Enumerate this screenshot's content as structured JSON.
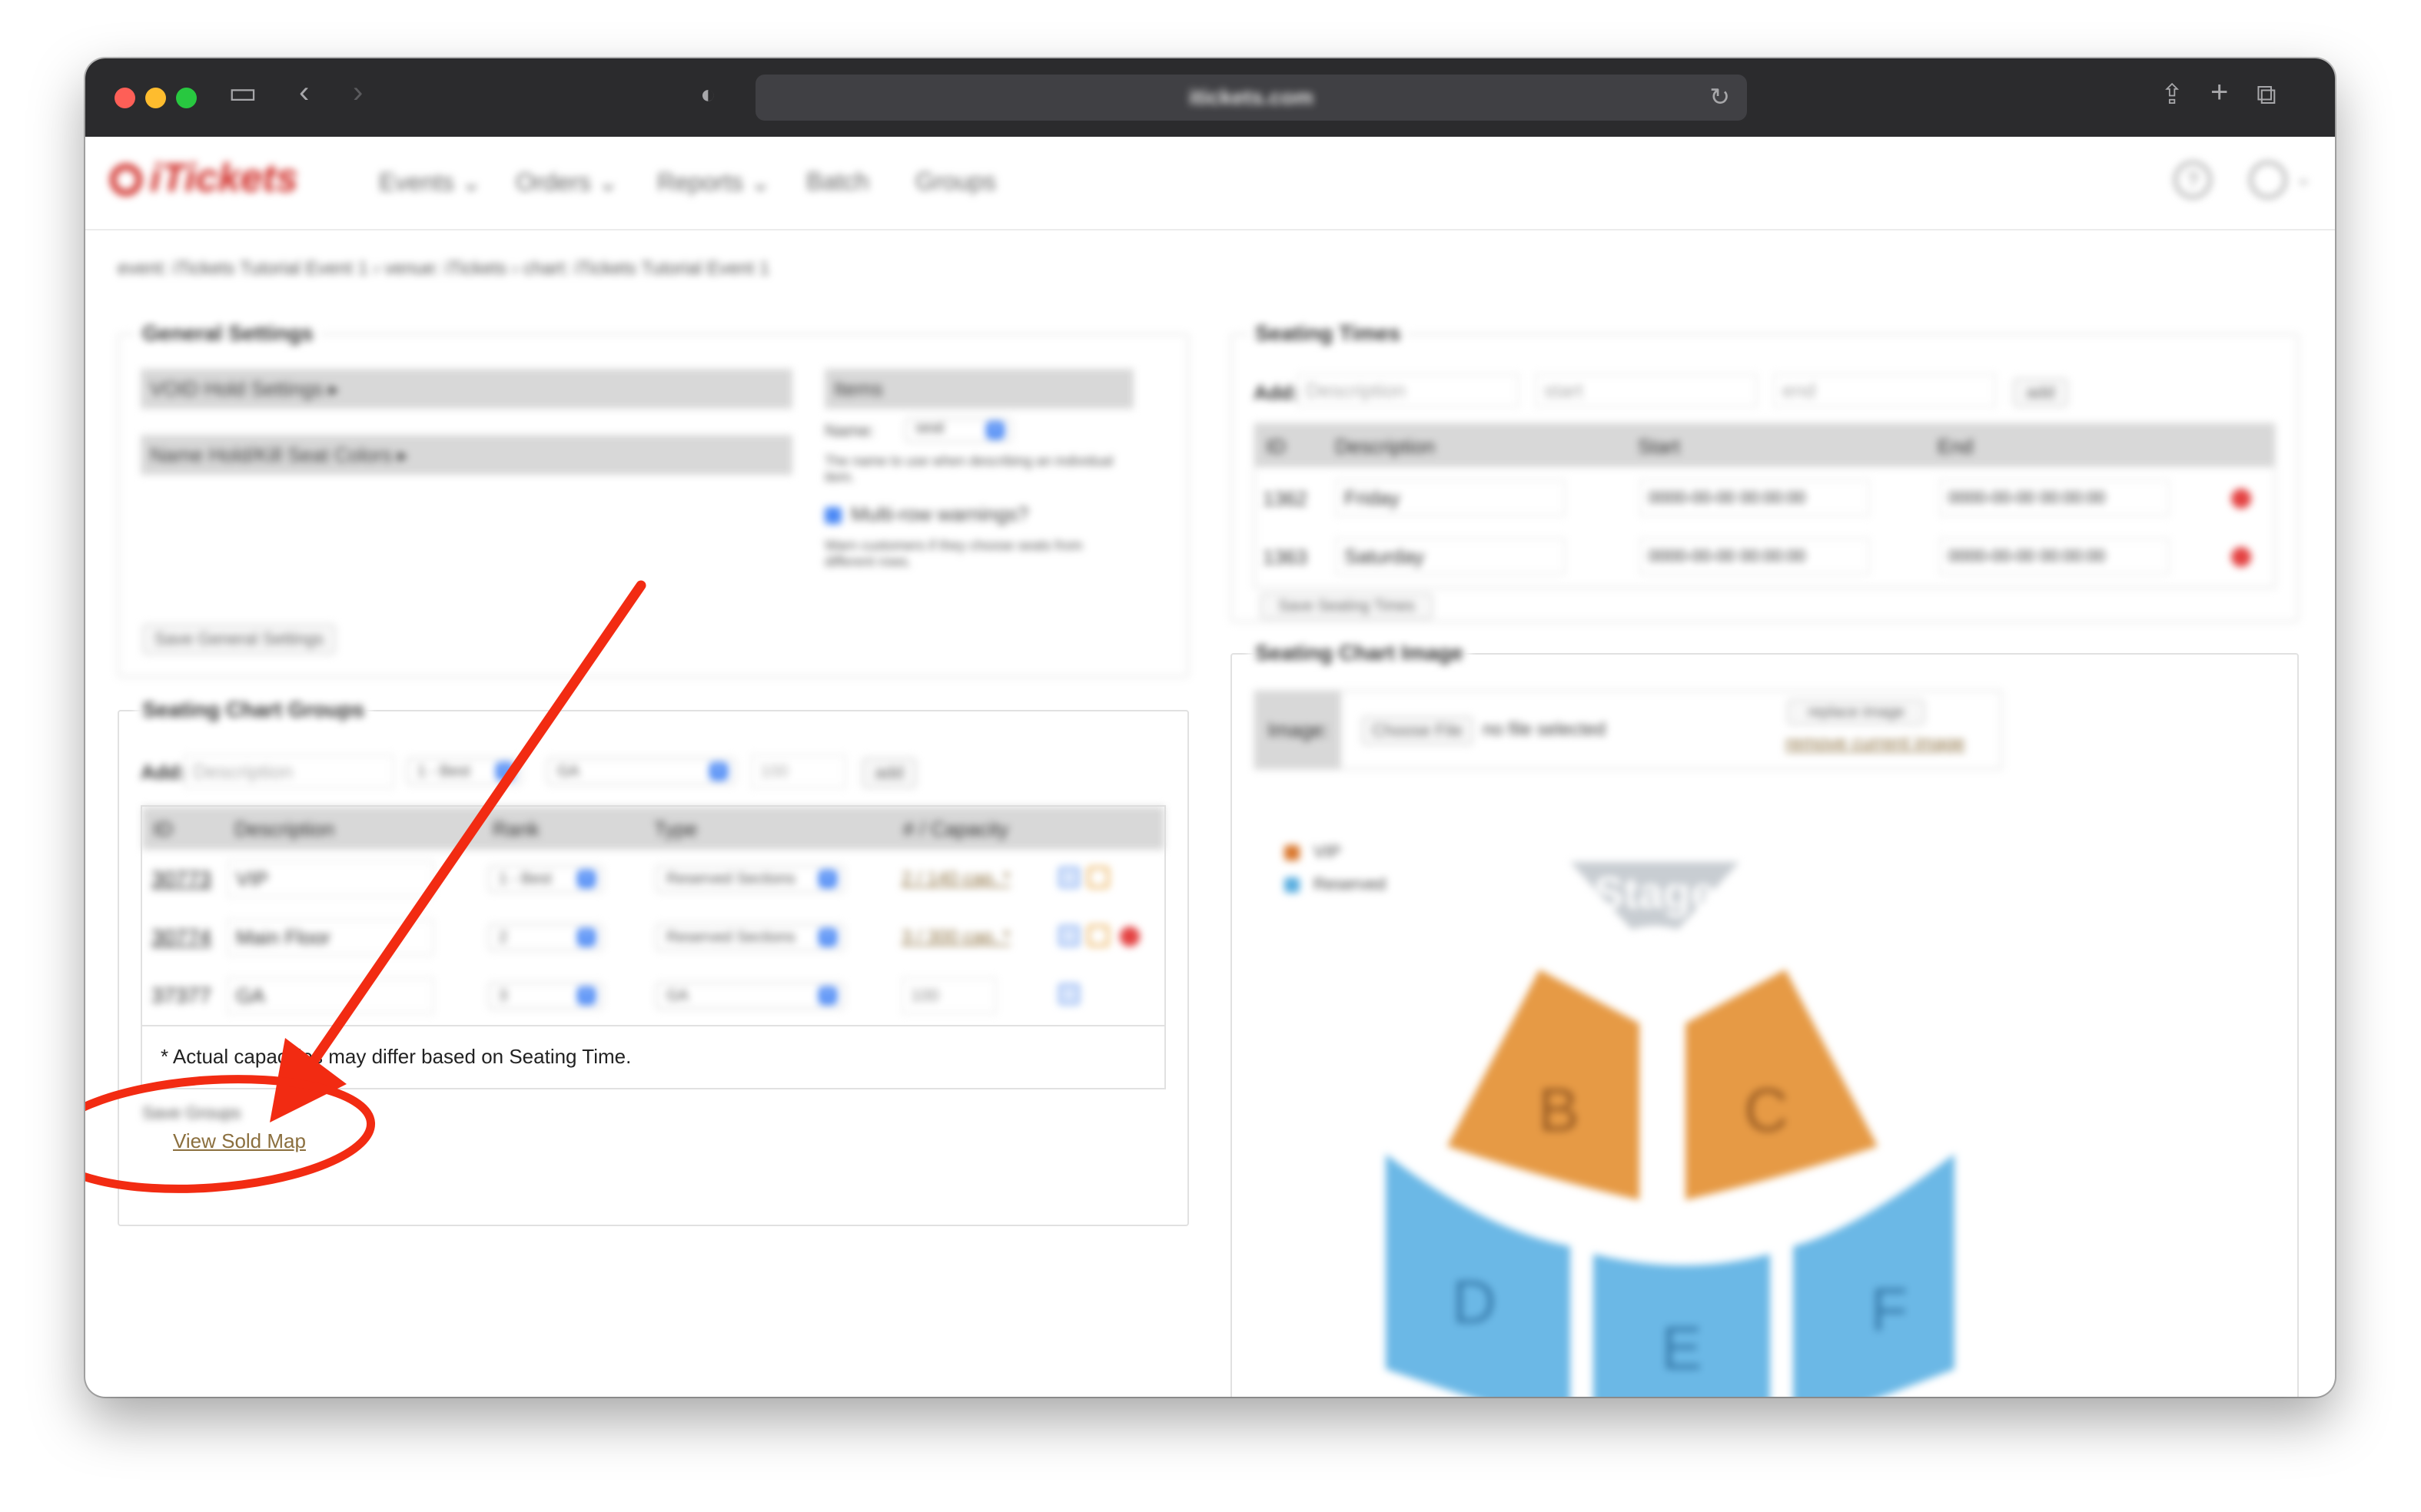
{
  "browser": {
    "url": "itickets.com"
  },
  "nav": {
    "brand": "iTickets",
    "menu": [
      "Events ⌄",
      "Orders ⌄",
      "Reports ⌄",
      "Batch",
      "Groups"
    ]
  },
  "breadcrumb": "event: iTickets Tutorial Event 1 › venue: iTickets › chart: iTickets Tutorial Event 1",
  "general_settings": {
    "title": "General Settings",
    "void_hold": "VOID Hold Settings ▸",
    "name_hold_kill": "Name Hold/Kill Seat Colors ▸",
    "item_header": "Items",
    "name_label": "Name:",
    "name_value": "seat",
    "name_help": "The name to use when describing an individual item.",
    "multirow_label": "Multi-row warnings?",
    "multirow_help": "Warn customers if they choose seats from different rows.",
    "save_button": "Save General Settings"
  },
  "seating_groups": {
    "title": "Seating Chart Groups",
    "add_label": "Add:",
    "add_desc_placeholder": "Description",
    "add_rank": "1 - Best",
    "add_type": "GA",
    "add_capacity": "100",
    "add_button": "add",
    "columns": [
      "ID",
      "Description",
      "Rank",
      "Type",
      "# / Capacity"
    ],
    "rows": [
      {
        "id": "30773",
        "description": "VIP",
        "rank": "1 - Best",
        "type": "Reserved Sections",
        "capacity": "2 / 140 cap. *"
      },
      {
        "id": "30774",
        "description": "Main Floor",
        "rank": "2",
        "type": "Reserved Sections",
        "capacity": "3 / 300 cap. *"
      },
      {
        "id": "37377",
        "description": "GA",
        "rank": "3",
        "type": "GA",
        "capacity": "100"
      }
    ],
    "footnote": "* Actual capacities may differ based on Seating Time.",
    "save_button": "Save Groups",
    "view_sold_map": "View Sold Map"
  },
  "seating_times": {
    "title": "Seating Times",
    "add_label": "Add:",
    "desc_placeholder": "Description",
    "start_placeholder": "start",
    "end_placeholder": "end",
    "add_button": "add",
    "columns": [
      "ID",
      "Description",
      "Start",
      "End"
    ],
    "rows": [
      {
        "id": "1362",
        "description": "Friday",
        "start": "0000-00-00 00:00:00",
        "end": "0000-00-00 00:00:00"
      },
      {
        "id": "1363",
        "description": "Saturday",
        "start": "0000-00-00 00:00:00",
        "end": "0000-00-00 00:00:00"
      }
    ],
    "save_button": "Save Seating Times"
  },
  "chart_image": {
    "title": "Seating Chart Image",
    "image_label": "Image:",
    "choose_file": "Choose File",
    "no_file": "no file selected",
    "replace": "replace image",
    "remove": "remove current image",
    "legend": [
      {
        "label": "VIP",
        "color": "#d9772d"
      },
      {
        "label": "Reserved",
        "color": "#5aaee0"
      }
    ],
    "stage": "Stage",
    "sections": [
      "B",
      "C",
      "D",
      "E",
      "F"
    ],
    "section_colors": {
      "vip": "#e69a45",
      "reserved": "#6bb8e6"
    }
  },
  "annotation": {
    "color": "#f22b12"
  }
}
